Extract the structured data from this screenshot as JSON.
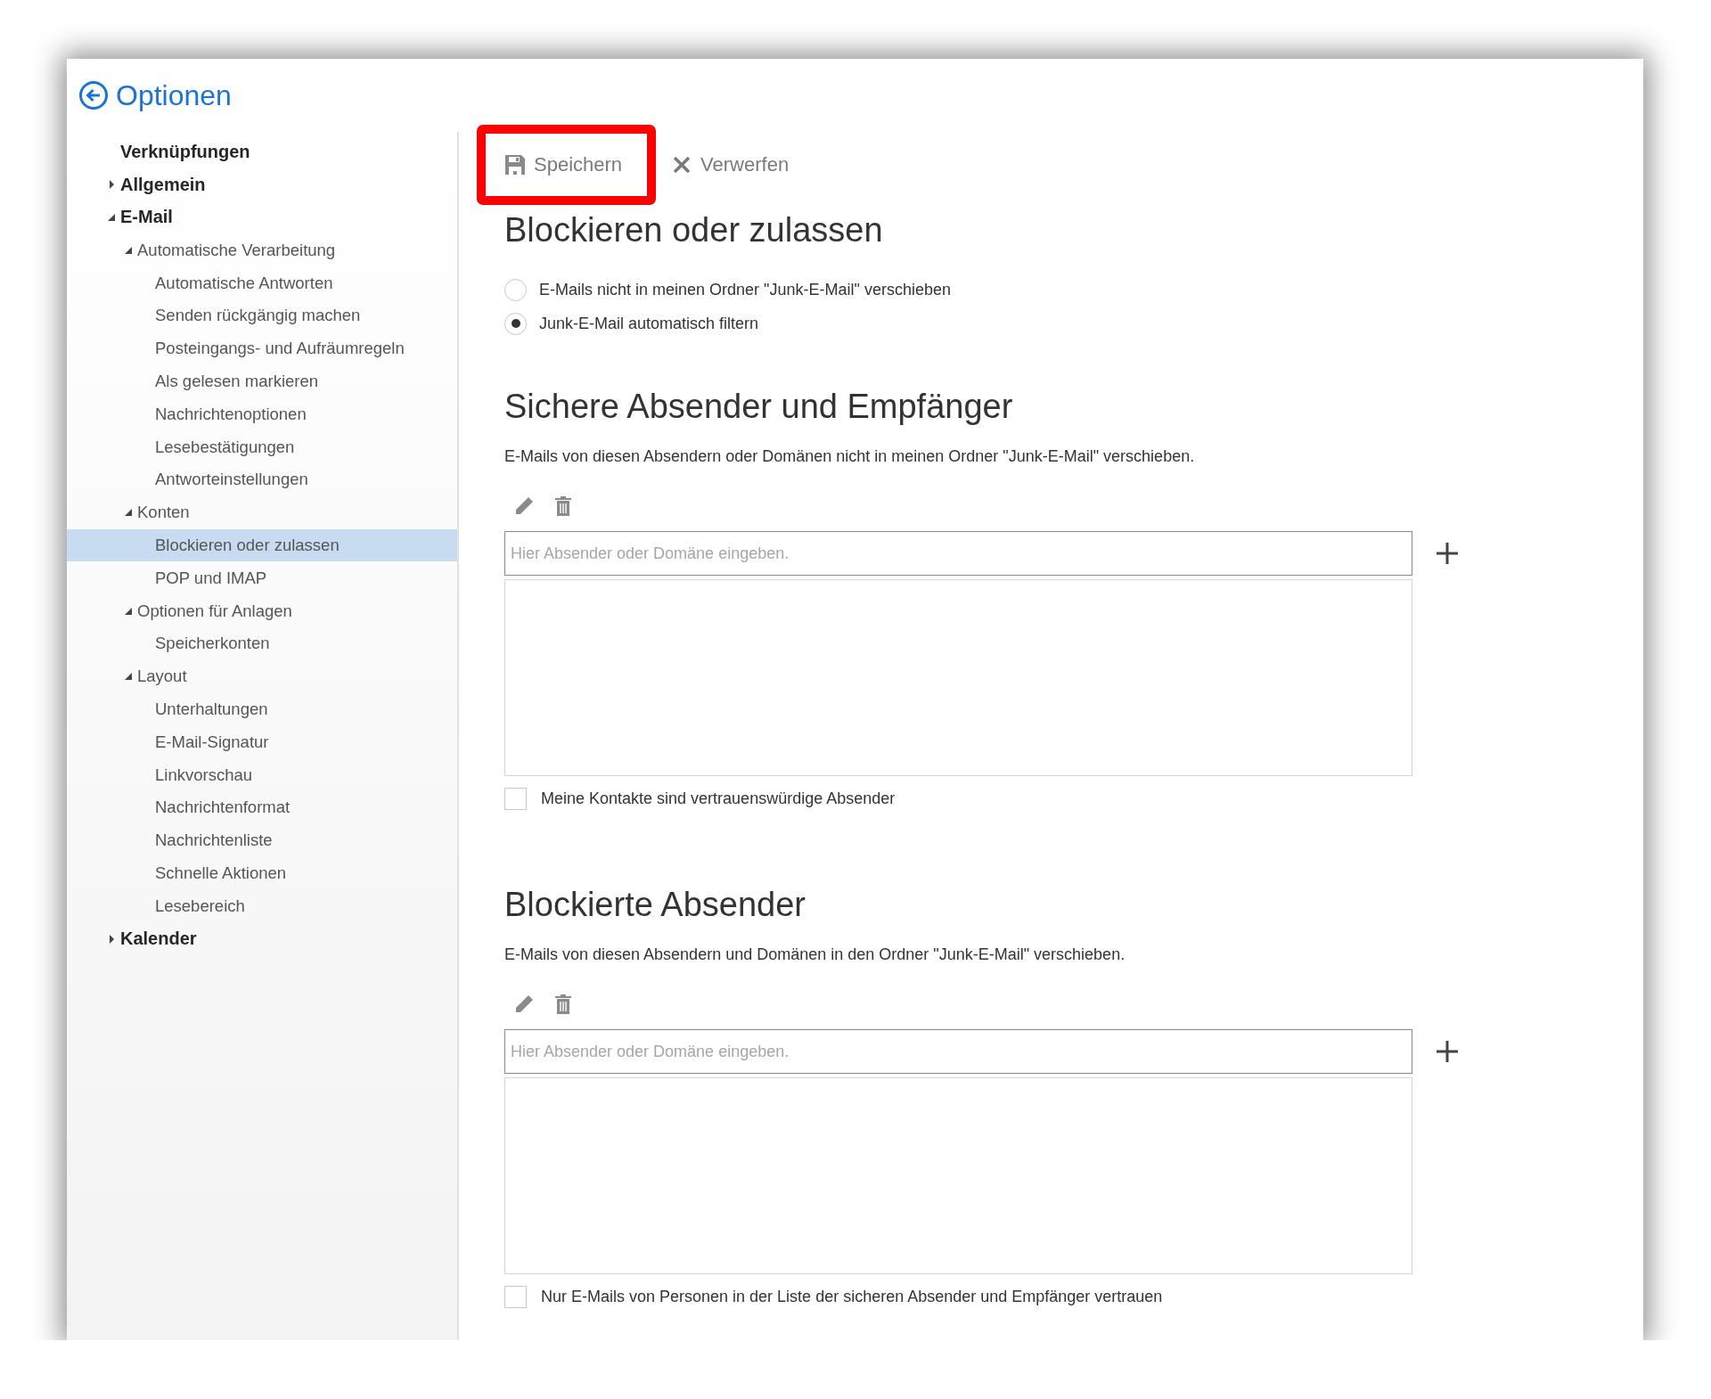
{
  "header": {
    "title": "Optionen"
  },
  "sidebar": {
    "items": [
      {
        "label": "Verknüpfungen",
        "selected": false
      },
      {
        "label": "Allgemein",
        "selected": false,
        "expanded": false
      },
      {
        "label": "E-Mail",
        "selected": false,
        "expanded": true,
        "children": [
          {
            "label": "Automatische Verarbeitung",
            "selected": false,
            "expanded": true,
            "children": [
              {
                "label": "Automatische Antworten",
                "selected": false
              },
              {
                "label": "Senden rückgängig machen",
                "selected": false
              },
              {
                "label": "Posteingangs- und Aufräumregeln",
                "selected": false
              },
              {
                "label": "Als gelesen markieren",
                "selected": false
              },
              {
                "label": "Nachrichtenoptionen",
                "selected": false
              },
              {
                "label": "Lesebestätigungen",
                "selected": false
              },
              {
                "label": "Antworteinstellungen",
                "selected": false
              }
            ]
          },
          {
            "label": "Konten",
            "selected": false,
            "expanded": true,
            "children": [
              {
                "label": "Blockieren oder zulassen",
                "selected": true
              },
              {
                "label": "POP und IMAP",
                "selected": false
              }
            ]
          },
          {
            "label": "Optionen für Anlagen",
            "selected": false,
            "expanded": true,
            "children": [
              {
                "label": "Speicherkonten",
                "selected": false
              }
            ]
          },
          {
            "label": "Layout",
            "selected": false,
            "expanded": true,
            "children": [
              {
                "label": "Unterhaltungen",
                "selected": false
              },
              {
                "label": "E-Mail-Signatur",
                "selected": false
              },
              {
                "label": "Linkvorschau",
                "selected": false
              },
              {
                "label": "Nachrichtenformat",
                "selected": false
              },
              {
                "label": "Nachrichtenliste",
                "selected": false
              },
              {
                "label": "Schnelle Aktionen",
                "selected": false
              },
              {
                "label": "Lesebereich",
                "selected": false
              }
            ]
          }
        ]
      },
      {
        "label": "Kalender",
        "selected": false,
        "expanded": false
      }
    ]
  },
  "toolbar": {
    "save": {
      "label": "Speichern",
      "highlighted": true
    },
    "discard": {
      "label": "Verwerfen"
    }
  },
  "title": "Blockieren oder zulassen",
  "filter_options": [
    {
      "label": "E-Mails nicht in meinen Ordner \"Junk-E-Mail\" verschieben",
      "selected": false
    },
    {
      "label": "Junk-E-Mail automatisch filtern",
      "selected": true
    }
  ],
  "sections": [
    {
      "heading": "Sichere Absender und Empfänger",
      "description": "E-Mails von diesen Absendern oder Domänen nicht in meinen Ordner \"Junk-E-Mail\" verschieben.",
      "input": {
        "placeholder": "Hier Absender oder Domäne eingeben."
      },
      "option": {
        "label": "Meine Kontakte sind vertrauenswürdige Absender",
        "checked": false
      }
    },
    {
      "heading": "Blockierte Absender",
      "description": "E-Mails von diesen Absendern und Domänen in den Ordner \"Junk-E-Mail\" verschieben.",
      "input": {
        "placeholder": "Hier Absender oder Domäne eingeben."
      },
      "option": {
        "label": "Nur E-Mails von Personen in der Liste der sicheren Absender und Empfänger vertrauen",
        "checked": false
      }
    }
  ]
}
